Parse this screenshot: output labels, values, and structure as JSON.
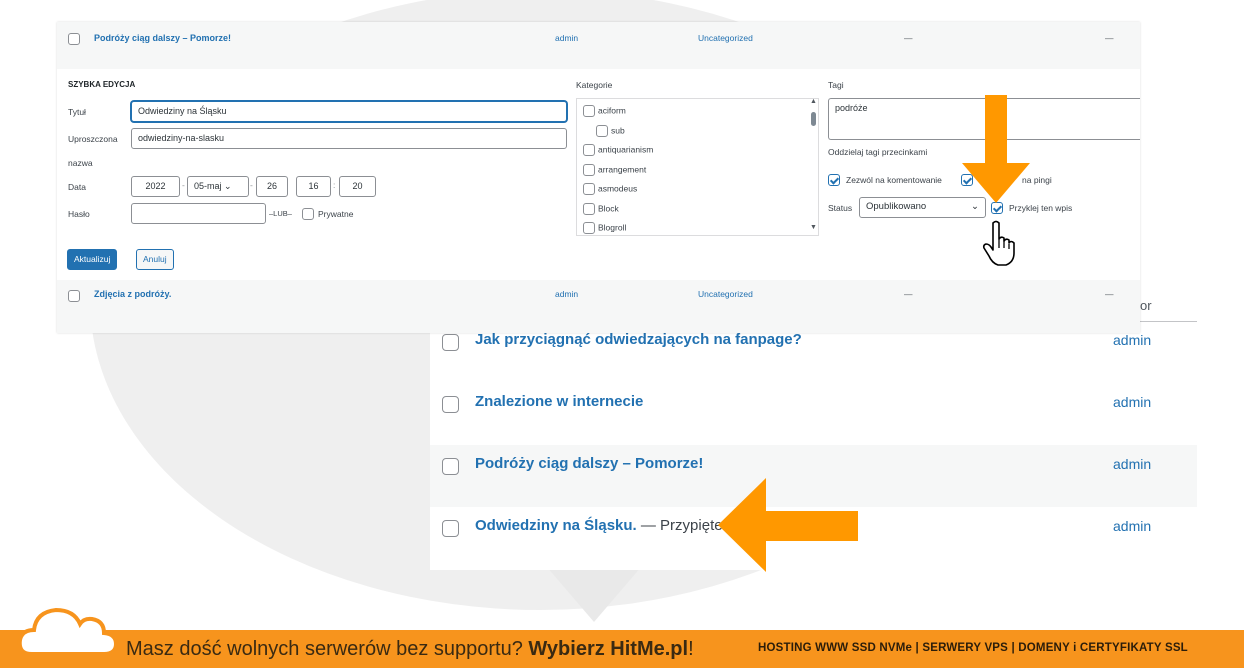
{
  "list": {
    "column_partial": "or",
    "rows": [
      {
        "title": "Jak przyciągnąć odwiedzających na fanpage?",
        "suffix": "",
        "author": "admin"
      },
      {
        "title": "Znalezione w internecie",
        "suffix": "",
        "author": "admin"
      },
      {
        "title": "Podróży ciąg dalszy – Pomorze!",
        "suffix": "",
        "author": "admin"
      },
      {
        "title": "Odwiedziny na Śląsku.",
        "suffix": " — Przypięte",
        "author": "admin"
      }
    ]
  },
  "quick_edit": {
    "row_top": {
      "title": "Podróży ciąg dalszy – Pomorze!",
      "author": "admin",
      "category": "Uncategorized",
      "tags": "—",
      "comments": "—"
    },
    "row_bottom": {
      "title": "Zdjęcia z podróży.",
      "author": "admin",
      "category": "Uncategorized",
      "tags": "—",
      "comments": "—"
    },
    "heading": "SZYBKA EDYCJA",
    "labels": {
      "title": "Tytuł",
      "slug_1": "Uproszczona",
      "slug_2": "nazwa",
      "date": "Data",
      "password": "Hasło",
      "categories": "Kategorie",
      "tags": "Tagi",
      "tags_hint": "Oddzielaj tagi przecinkami",
      "allow_comments": "Zezwól na komentowanie",
      "allow_pings": "na pingi",
      "status": "Status",
      "sticky": "Przyklej ten wpis",
      "or": "–LUB–",
      "private": "Prywatne"
    },
    "values": {
      "title": "Odwiedziny na Śląsku",
      "slug": "odwiedziny-na-slasku",
      "year": "2022",
      "month": "05-maj",
      "day": "26",
      "hour": "16",
      "minute": "20",
      "password": "",
      "tags": "podróże",
      "status": "Opublikowano"
    },
    "categories": [
      {
        "name": "aciform",
        "indent": false
      },
      {
        "name": "sub",
        "indent": true
      },
      {
        "name": "antiquarianism",
        "indent": false
      },
      {
        "name": "arrangement",
        "indent": false
      },
      {
        "name": "asmodeus",
        "indent": false
      },
      {
        "name": "Block",
        "indent": false
      },
      {
        "name": "Blogroll",
        "indent": false
      }
    ],
    "buttons": {
      "update": "Aktualizuj",
      "cancel": "Anuluj"
    }
  },
  "footer": {
    "lead": "Masz dość wolnych serwerów bez supportu? ",
    "brand": "Wybierz HitMe.pl",
    "bang": "!",
    "services": "HOSTING WWW SSD NVMe | SERWERY VPS | DOMENY i CERTYFIKATY SSL"
  },
  "colors": {
    "accent": "#2271b1",
    "arrow": "#ff9800",
    "footer": "#f7941d"
  }
}
